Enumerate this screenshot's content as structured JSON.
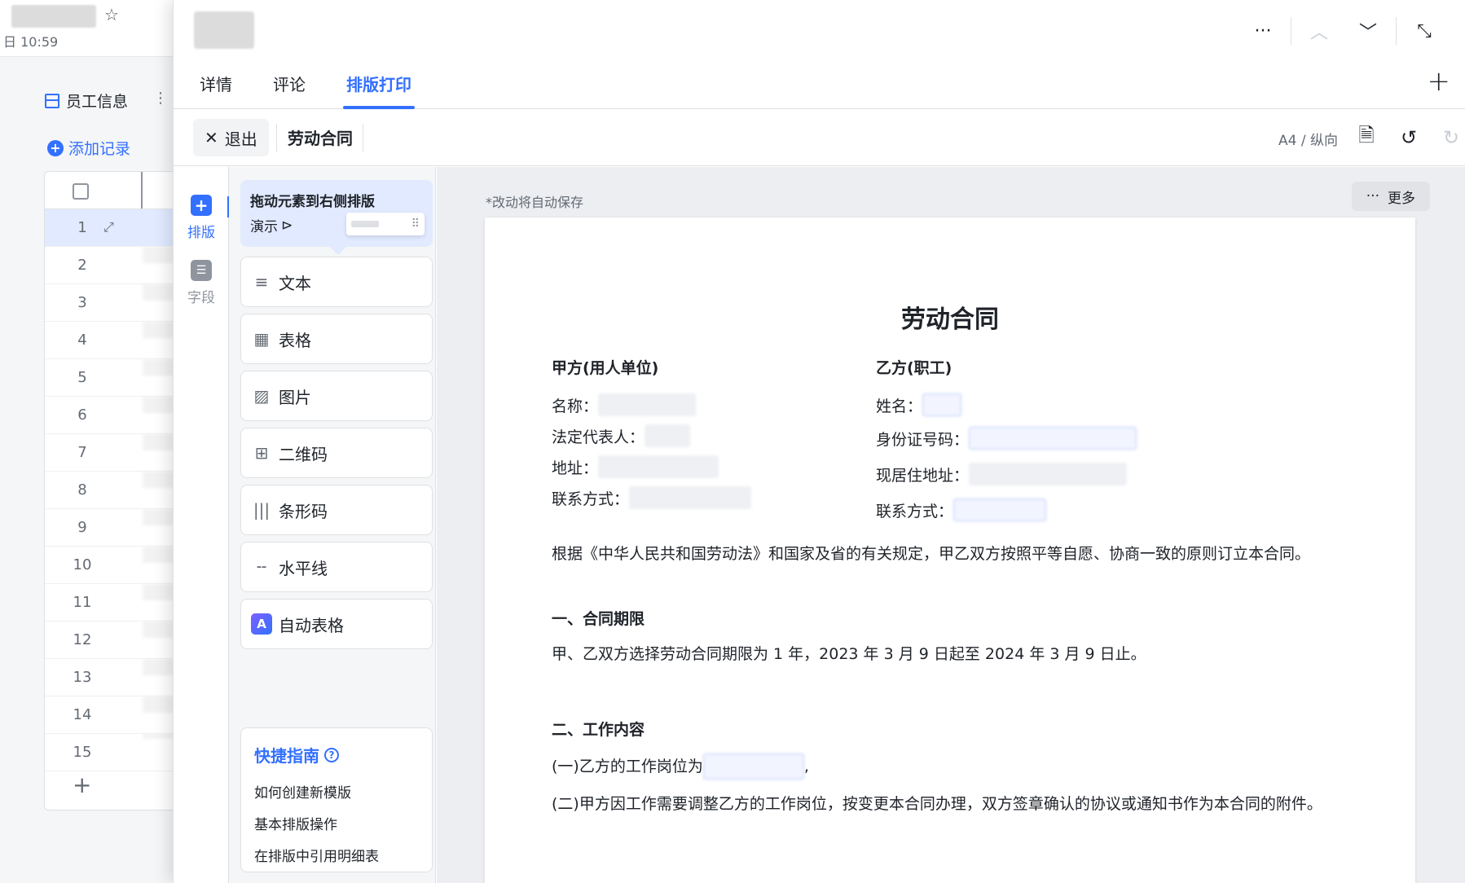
{
  "background_app": {
    "time": "日 10:59",
    "sheet_name": "员工信息",
    "add_record": "添加记录",
    "row_numbers": [
      "1",
      "2",
      "3",
      "4",
      "5",
      "6",
      "7",
      "8",
      "9",
      "10",
      "11",
      "12",
      "13",
      "14",
      "15"
    ],
    "add_row": "+"
  },
  "panel": {
    "top_actions": {
      "more": "···",
      "prev": "︿",
      "next": "﹀",
      "collapse": "⤡"
    },
    "tabs": [
      {
        "label": "详情"
      },
      {
        "label": "评论"
      },
      {
        "label": "排版打印"
      }
    ],
    "tab_add": "+"
  },
  "toolbar": {
    "exit_label": "退出",
    "doc_name": "劳动合同",
    "page_setting": "A4 / 纵向"
  },
  "rail": {
    "layout_label": "排版",
    "fields_label": "字段"
  },
  "palette": {
    "hint_title": "拖动元素到右侧排版",
    "hint_demo": "演示",
    "elements": [
      {
        "label": "文本",
        "icon": "text-icon"
      },
      {
        "label": "表格",
        "icon": "table-icon"
      },
      {
        "label": "图片",
        "icon": "image-icon"
      },
      {
        "label": "二维码",
        "icon": "qrcode-icon"
      },
      {
        "label": "条形码",
        "icon": "barcode-icon"
      },
      {
        "label": "水平线",
        "icon": "divider-icon"
      },
      {
        "label": "自动表格",
        "icon": "auto-table-icon"
      }
    ],
    "guide_title": "快捷指南",
    "guide_links": [
      "如何创建新模版",
      "基本排版操作",
      "在排版中引用明细表"
    ]
  },
  "canvas": {
    "autosave_note": "*改动将自动保存",
    "more_label": "更多",
    "document": {
      "title": "劳动合同",
      "party_a": {
        "heading": "甲方(用人单位)",
        "name_label": "名称：",
        "legal_rep_label": "法定代表人：",
        "address_label": "地址：",
        "contact_label": "联系方式："
      },
      "party_b": {
        "heading": "乙方(职工)",
        "name_label": "姓名：",
        "id_label": "身份证号码：",
        "address_label": "现居住地址：",
        "contact_label": "联系方式："
      },
      "intro": "根据《中华人民共和国劳动法》和国家及省的有关规定，甲乙双方按照平等自愿、协商一致的原则订立本合同。",
      "section1_title": "一、合同期限",
      "section1_text": "甲、乙双方选择劳动合同期限为 1 年，2023 年  3  月  9  日起至     2024  年 3 月 9 日止。",
      "section2_title": "二、工作内容",
      "section2_item1": "(一)乙方的工作岗位为",
      "section2_item2": "(二)甲方因工作需要调整乙方的工作岗位，按变更本合同办理，双方签章确认的协议或通知书作为本合同的附件。"
    }
  }
}
